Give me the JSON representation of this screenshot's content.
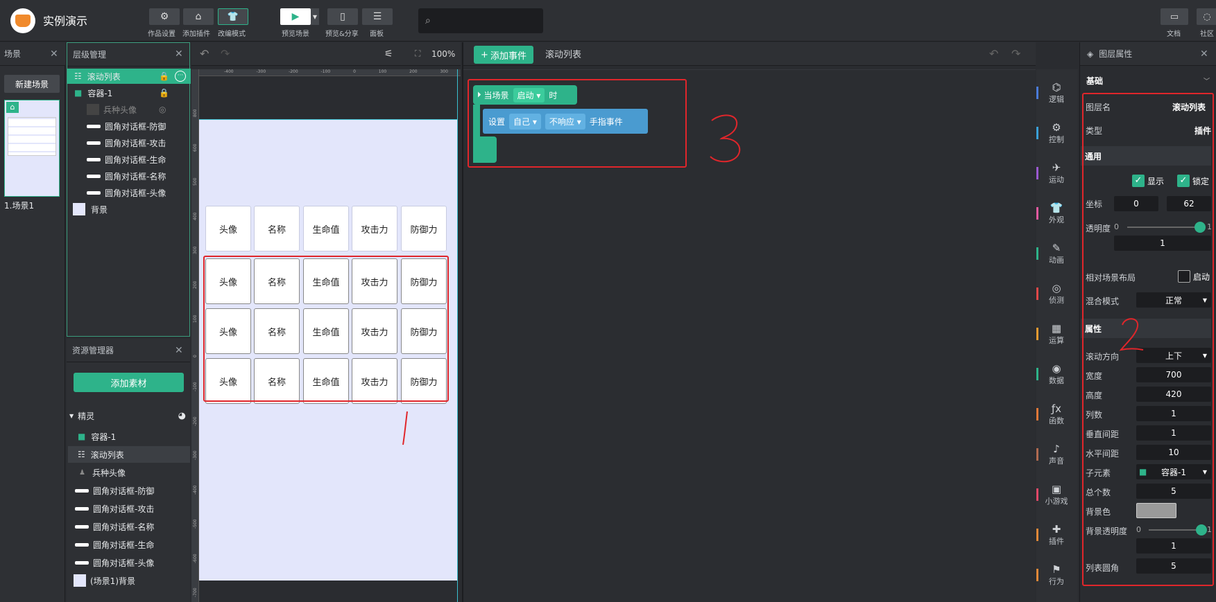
{
  "app": {
    "title": "实例演示",
    "search_placeholder": ""
  },
  "toolbar": {
    "work_settings": "作品设置",
    "add_plugin": "添加插件",
    "edit_mode": "改编模式",
    "preview_scene": "预览场景",
    "preview_share": "预览&分享",
    "panel": "面板",
    "docs": "文档",
    "community": "社区"
  },
  "scene_panel": {
    "title": "场景",
    "new_scene": "新建场景",
    "scene_name": "1.场景1"
  },
  "layer_panel": {
    "title": "层级管理",
    "items": [
      "滚动列表",
      "容器-1",
      "兵种头像",
      "圆角对话框-防御",
      "圆角对话框-攻击",
      "圆角对话框-生命",
      "圆角对话框-名称",
      "圆角对话框-头像",
      "背景"
    ]
  },
  "resource_panel": {
    "title": "资源管理器",
    "add_button": "添加素材",
    "group": "精灵",
    "items": [
      "容器-1",
      "滚动列表",
      "兵种头像",
      "圆角对话框-防御",
      "圆角对话框-攻击",
      "圆角对话框-名称",
      "圆角对话框-生命",
      "圆角对话框-头像",
      "(场景1)背景"
    ]
  },
  "canvas": {
    "zoom": "100%",
    "ruler_top": [
      "-400",
      "-300",
      "-200",
      "-100",
      "0",
      "100",
      "200",
      "300"
    ],
    "ruler_left": [
      "800",
      "600",
      "500",
      "400",
      "300",
      "200",
      "100",
      "0",
      "-100",
      "-200",
      "-300",
      "-400",
      "-500",
      "-600",
      "-700"
    ],
    "header_row": [
      "头像",
      "名称",
      "生命值",
      "攻击力",
      "防御力"
    ],
    "rows": [
      [
        "头像",
        "名称",
        "生命值",
        "攻击力",
        "防御力"
      ],
      [
        "头像",
        "名称",
        "生命值",
        "攻击力",
        "防御力"
      ],
      [
        "头像",
        "名称",
        "生命值",
        "攻击力",
        "防御力"
      ]
    ]
  },
  "event_panel": {
    "add_event": "添加事件",
    "current": "滚动列表",
    "block1": {
      "a": "当场景",
      "b": "启动",
      "c": "时"
    },
    "block2": {
      "a": "设置",
      "b": "自己",
      "c": "不响应",
      "d": "手指事件"
    }
  },
  "categories": [
    {
      "label": "逻辑",
      "icon": "⌬",
      "color": "#4a7bd9"
    },
    {
      "label": "控制",
      "icon": "⚙",
      "color": "#3aa0d8"
    },
    {
      "label": "运动",
      "icon": "✈",
      "color": "#9b59d0"
    },
    {
      "label": "外观",
      "icon": "👕",
      "color": "#e25aa0"
    },
    {
      "label": "动画",
      "icon": "✎",
      "color": "#2eb38a"
    },
    {
      "label": "侦测",
      "icon": "◎",
      "color": "#e04848"
    },
    {
      "label": "运算",
      "icon": "▦",
      "color": "#e89a30"
    },
    {
      "label": "数据",
      "icon": "◉",
      "color": "#2eb38a"
    },
    {
      "label": "函数",
      "icon": "ƒx",
      "color": "#e07838"
    },
    {
      "label": "声音",
      "icon": "♪",
      "color": "#b06a50"
    },
    {
      "label": "小游戏",
      "icon": "▣",
      "color": "#e04868"
    },
    {
      "label": "插件",
      "icon": "✚",
      "color": "#e08838"
    },
    {
      "label": "行为",
      "icon": "⚑",
      "color": "#e08838"
    }
  ],
  "props": {
    "title": "图层属性",
    "basic": "基础",
    "layer_name_label": "图层名",
    "layer_name": "滚动列表",
    "type_label": "类型",
    "type": "插件",
    "general": "通用",
    "show": "显示",
    "lock": "锁定",
    "coord_label": "坐标",
    "x": "0",
    "y": "62",
    "opacity_label": "透明度",
    "opacity_min": "0",
    "opacity_max": "1",
    "opacity": "1",
    "relative_label": "相对场景布局",
    "relative": "启动",
    "blend_label": "混合模式",
    "blend": "正常",
    "attr": "属性",
    "scroll_dir_label": "滚动方向",
    "scroll_dir": "上下",
    "width_label": "宽度",
    "width": "700",
    "height_label": "高度",
    "height": "420",
    "cols_label": "列数",
    "cols": "1",
    "vgap_label": "垂直间距",
    "vgap": "1",
    "hgap_label": "水平间距",
    "hgap": "10",
    "child_label": "子元素",
    "child": "容器-1",
    "total_label": "总个数",
    "total": "5",
    "bg_label": "背景色",
    "bg_color": "#9a9a9a",
    "bg_opacity_label": "背景透明度",
    "bg_opacity_min": "0",
    "bg_opacity_max": "1",
    "bg_opacity": "1",
    "radius_label": "列表圆角",
    "radius": "5"
  },
  "annotations": {
    "a1": "1",
    "a2": "2",
    "a3": "3"
  }
}
